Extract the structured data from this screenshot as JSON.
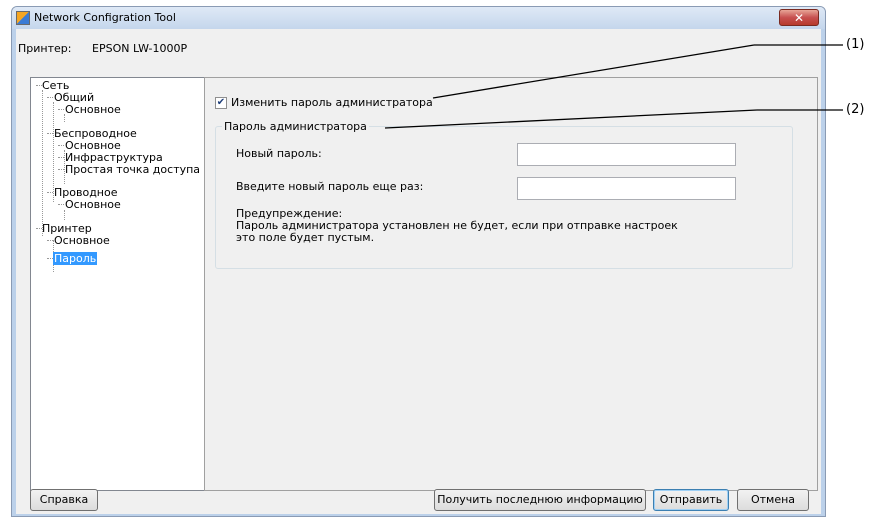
{
  "window": {
    "title": "Network Configration Tool",
    "close_label": "✕"
  },
  "printer": {
    "label": "Принтер:",
    "value": "EPSON LW-1000P"
  },
  "tree": {
    "items": [
      "Сеть",
      "Общий",
      "Основное",
      "Беспроводное",
      "Основное",
      "Инфраструктура",
      "Простая точка доступа",
      "Проводное",
      "Основное",
      "Принтер",
      "Основное",
      "Пароль"
    ],
    "selected_index": 11
  },
  "panel": {
    "checkbox": {
      "checked": true,
      "label": "Изменить пароль администратора"
    },
    "group": {
      "title": "Пароль администратора",
      "new_password_label": "Новый пароль:",
      "new_password_value": "",
      "confirm_password_label": "Введите новый пароль еще раз:",
      "confirm_password_value": "",
      "warning_title": "Предупреждение:",
      "warning_line1": "Пароль администратора установлен не будет, если при отправке настроек",
      "warning_line2": "это поле будет пустым."
    }
  },
  "buttons": {
    "help": "Справка",
    "get_info": "Получить последнюю информацию",
    "send": "Отправить",
    "cancel": "Отмена"
  },
  "annotations": {
    "a1": "(1)",
    "a2": "(2)"
  }
}
